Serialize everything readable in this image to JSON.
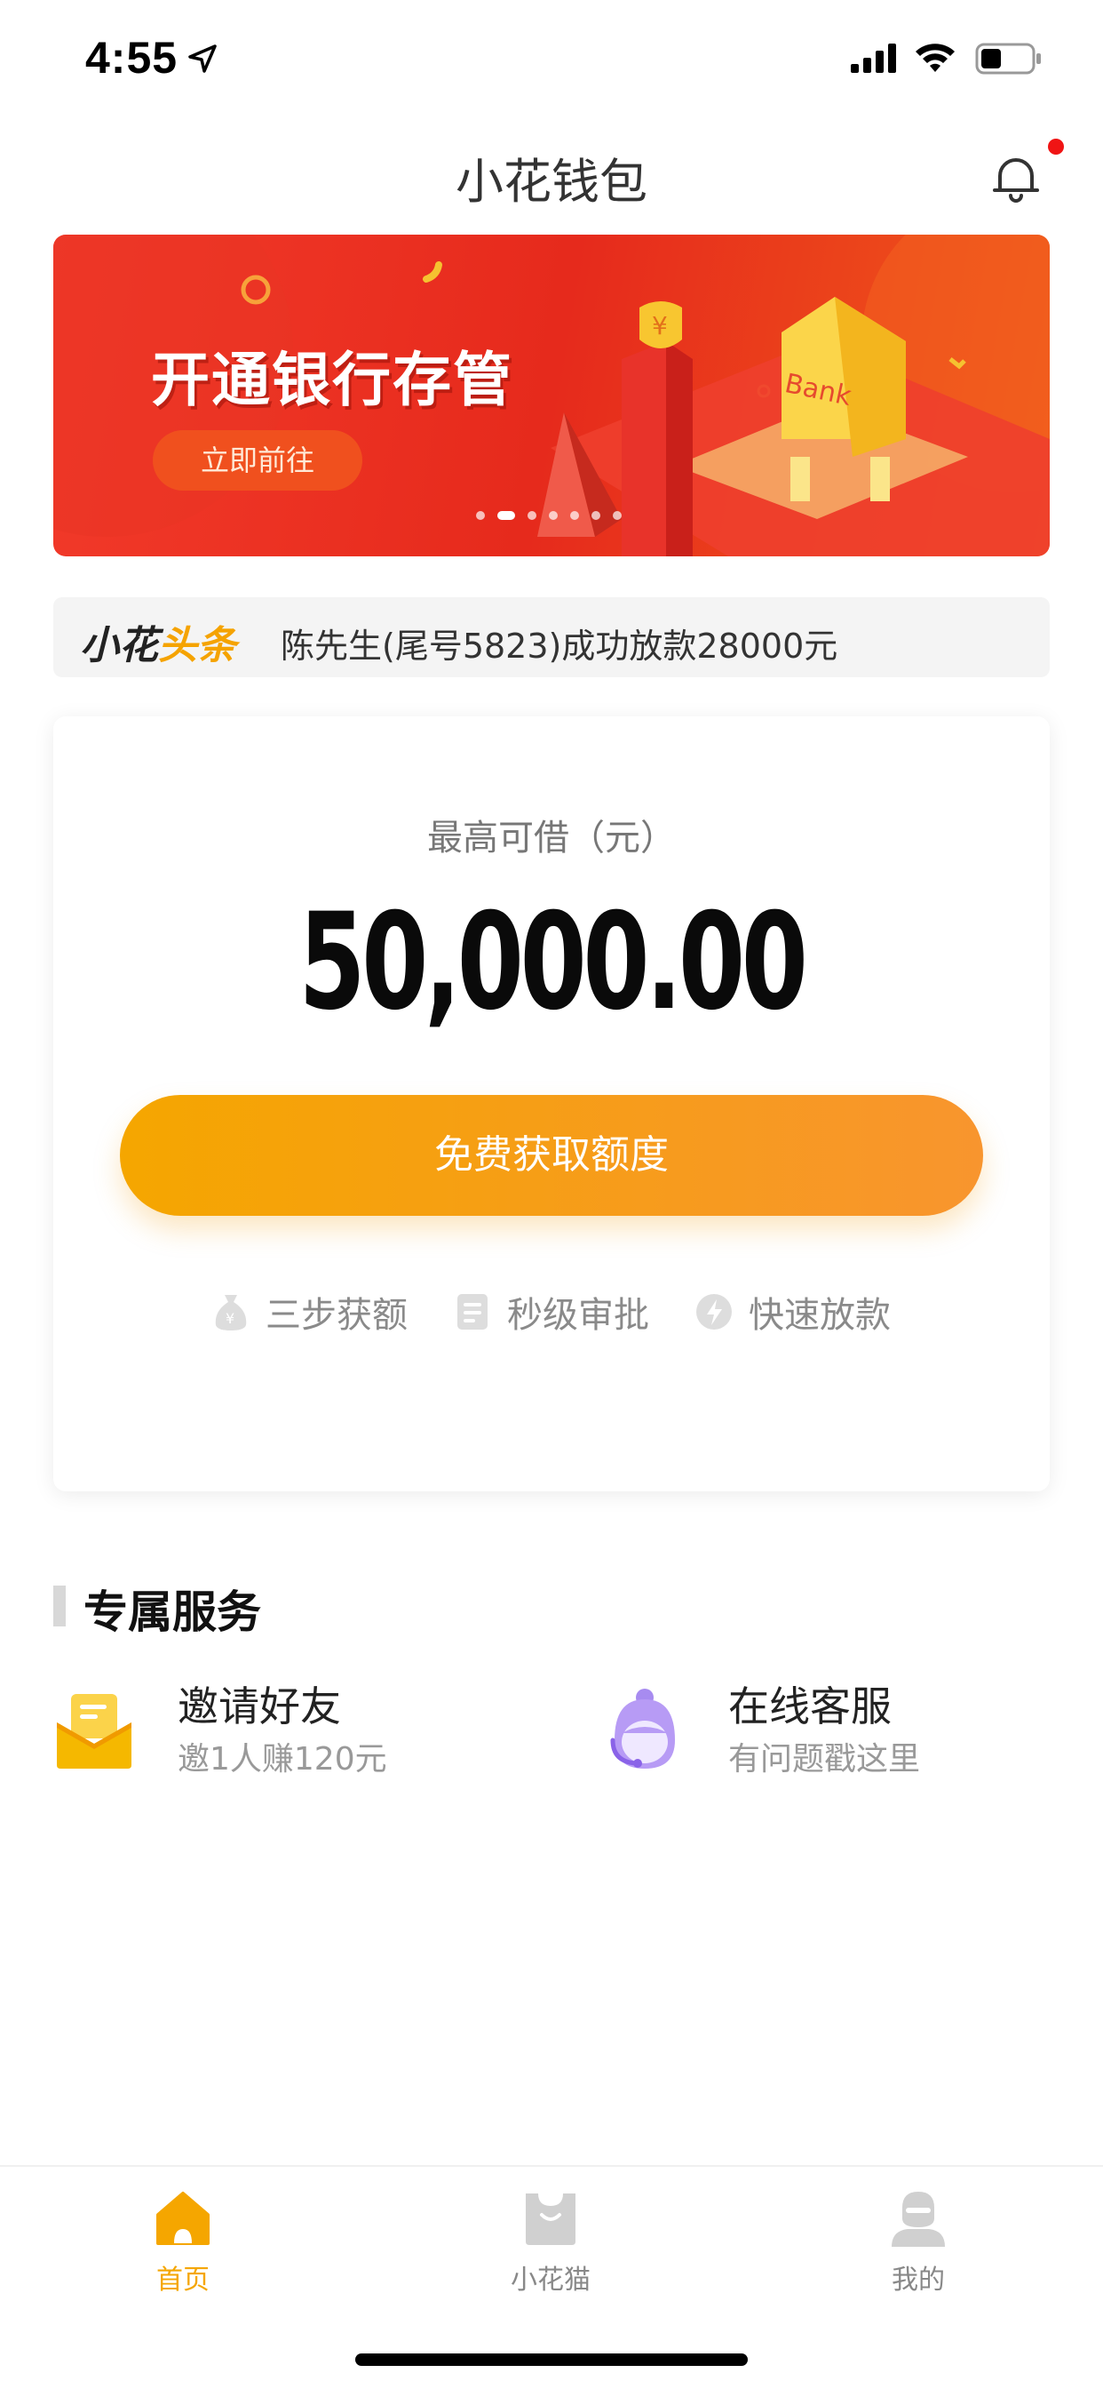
{
  "status_bar": {
    "time": "4:55"
  },
  "nav": {
    "title": "小花钱包"
  },
  "banner": {
    "title": "开通银行存管",
    "button_label": "立即前往",
    "building_label": "Bank",
    "dots_count": 7
  },
  "ticker": {
    "brand_part1": "小花",
    "brand_part2": "头条",
    "text": "陈先生(尾号5823)成功放款28000元"
  },
  "loan": {
    "label": "最高可借（元）",
    "amount": "50,000.00",
    "button_label": "免费获取额度",
    "features": [
      {
        "icon": "money-bag-icon",
        "label": "三步获额"
      },
      {
        "icon": "document-icon",
        "label": "秒级审批"
      },
      {
        "icon": "lightning-icon",
        "label": "快速放款"
      }
    ]
  },
  "services": {
    "title": "专属服务",
    "items": [
      {
        "icon": "envelope-icon",
        "title": "邀请好友",
        "subtitle": "邀1人赚120元"
      },
      {
        "icon": "customer-service-icon",
        "title": "在线客服",
        "subtitle": "有问题戳这里"
      }
    ]
  },
  "tabs": [
    {
      "icon": "home-icon",
      "label": "首页",
      "active": true
    },
    {
      "icon": "bag-icon",
      "label": "小花猫",
      "active": false
    },
    {
      "icon": "user-icon",
      "label": "我的",
      "active": false
    }
  ],
  "colors": {
    "accent": "#f5a600",
    "banner_red": "#e62a1c",
    "notification_dot": "#f01414"
  }
}
